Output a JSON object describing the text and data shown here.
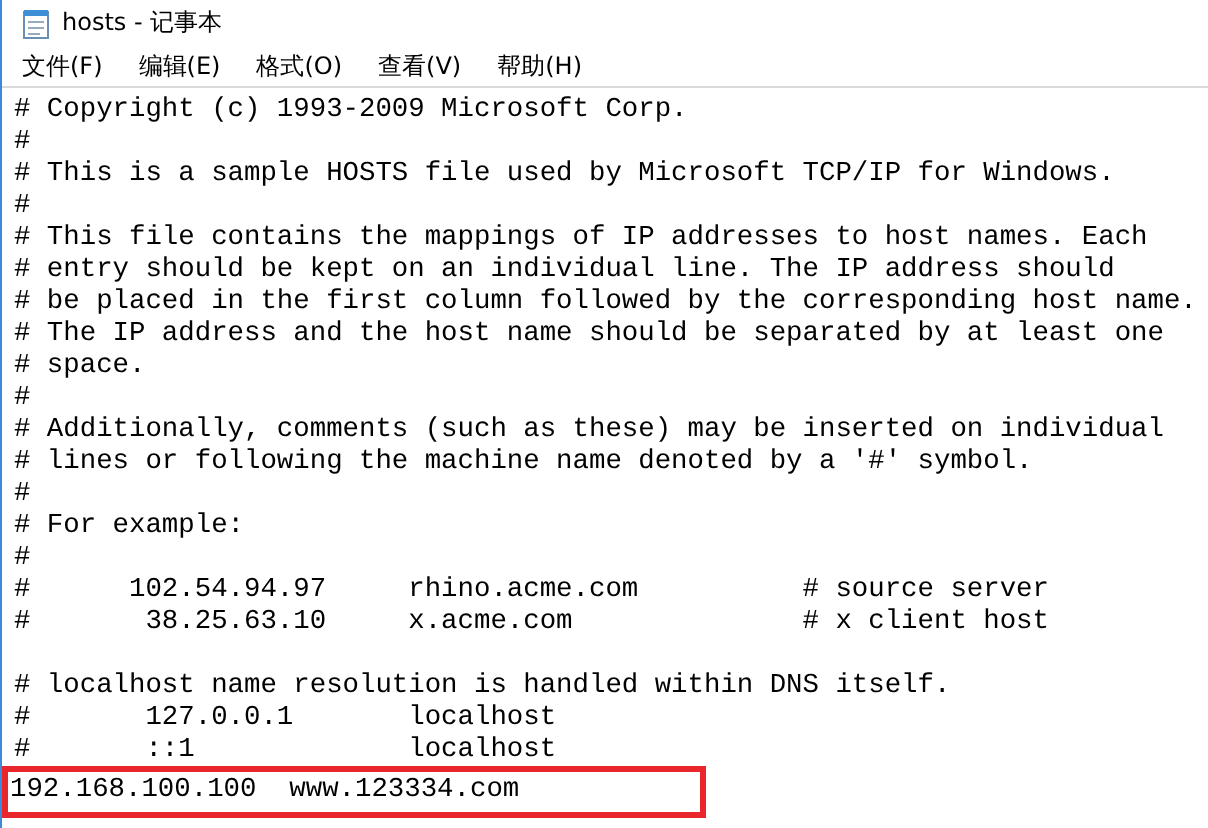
{
  "window": {
    "title": "hosts - 记事本"
  },
  "menu": [
    "文件(F)",
    "编辑(E)",
    "格式(O)",
    "查看(V)",
    "帮助(H)"
  ],
  "editor": {
    "paragraphs": [
      {
        "lines": [
          "# Copyright (c) 1993-2009 Microsoft Corp.",
          "#",
          "# This is a sample HOSTS file used by Microsoft TCP/IP for Windows.",
          "#",
          "# This file contains the mappings of IP addresses to host names. Each",
          "# entry should be kept on an individual line. The IP address should",
          "# be placed in the first column followed by the corresponding host name.",
          "# The IP address and the host name should be separated by at least one",
          "# space.",
          "#",
          "# Additionally, comments (such as these) may be inserted on individual",
          "# lines or following the machine name denoted by a '#' symbol.",
          "#",
          "# For example:",
          "#",
          "#      102.54.94.97     rhino.acme.com          # source server",
          "#       38.25.63.10     x.acme.com              # x client host"
        ]
      },
      {
        "lines": [
          "# localhost name resolution is handled within DNS itself.",
          "#       127.0.0.1       localhost",
          "#       ::1             localhost"
        ]
      }
    ],
    "highlighted_line": "192.168.100.100  www.123334.com"
  }
}
